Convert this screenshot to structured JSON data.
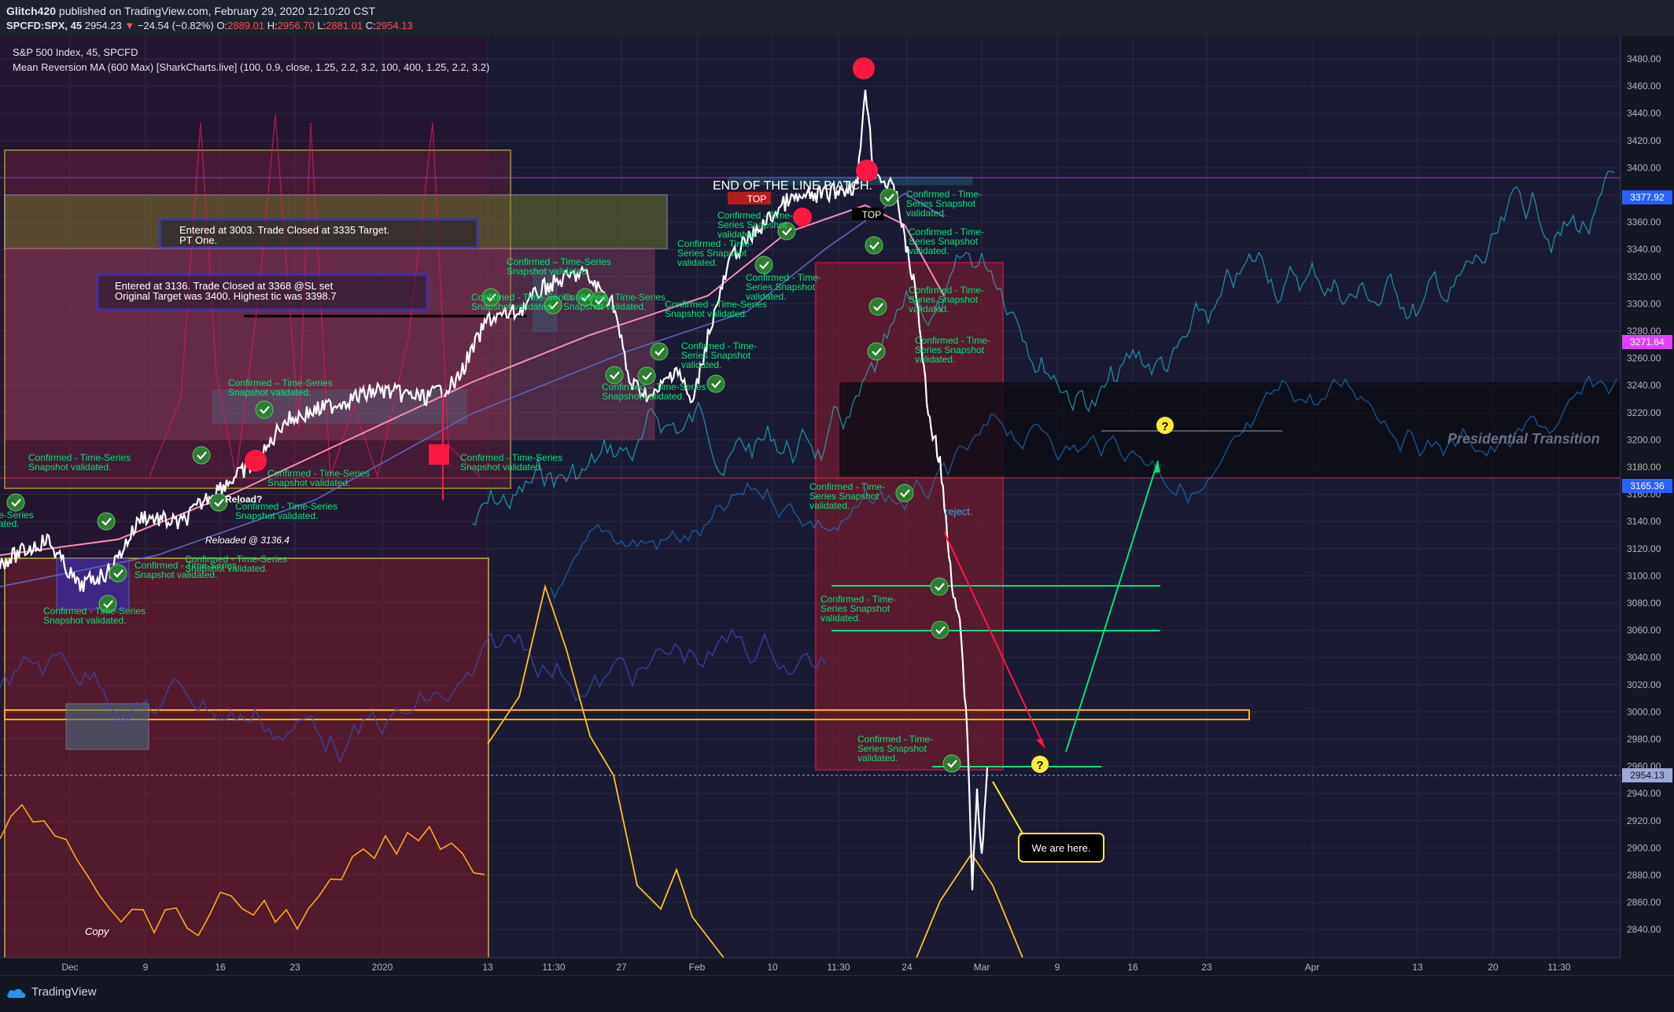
{
  "header": {
    "author": "Glitch420",
    "published": "published on TradingView.com, February 29, 2020 12:10:20 CST",
    "symbol": "SPCFD:SPX, 45",
    "last": "2954.23",
    "change": "−24.54 (−0.82%)",
    "o_label": "O:",
    "o_val": "2889.01",
    "h_label": "H:",
    "h_val": "2956.70",
    "l_label": "L:",
    "l_val": "2881.01",
    "c_label": "C:",
    "c_val": "2954.13"
  },
  "legend": {
    "title": "S&P 500 Index, 45, SPCFD",
    "indicator": "Mean Reversion MA (600 Max) [SharkCharts.live] (100, 0.9, close, 1.25, 2.2, 3.2, 100, 400, 1.25, 2.2, 3.2)"
  },
  "price_axis": {
    "ticks": [
      "3480.00",
      "3460.00",
      "3440.00",
      "3420.00",
      "3400.00",
      "3380.00",
      "3360.00",
      "3340.00",
      "3320.00",
      "3300.00",
      "3280.00",
      "3260.00",
      "3240.00",
      "3220.00",
      "3200.00",
      "3180.00",
      "3160.00",
      "3140.00",
      "3120.00",
      "3100.00",
      "3080.00",
      "3060.00",
      "3040.00",
      "3020.00",
      "3000.00",
      "2980.00",
      "2960.00",
      "2940.00",
      "2920.00",
      "2900.00",
      "2880.00",
      "2860.00",
      "2840.00"
    ],
    "badge_top": "3377.92",
    "badge_pink": "3271.64",
    "badge_mid": "3165.36",
    "badge_last": "2954.13"
  },
  "time_axis": {
    "ticks": [
      "Dec",
      "9",
      "16",
      "23",
      "2020",
      "13",
      "11:30",
      "27",
      "Feb",
      "10",
      "11:30",
      "24",
      "Mar",
      "9",
      "16",
      "23",
      "Apr",
      "13",
      "20",
      "11:30"
    ]
  },
  "annotations": {
    "trade1": "Entered at 3003. Trade Closed  at 3335 Target.\nPT One.",
    "trade2": "Entered at 3136. Trade Closed at 3368 @SL  set\nOriginal Target was 3400. Highest tic was 3398.7",
    "end_of_line": "END OF THE LINE BIATCH.",
    "top1": "TOP",
    "top2": "TOP",
    "presidential": "Presidential Transition",
    "we_are_here": "We are here.",
    "reject": "reject.",
    "reload": "Reload?",
    "reloaded": "Reloaded @ 3136.4",
    "copy": "Copy",
    "confirm1": "Confirmed - Time-Series\nSnapshot validated.",
    "confirm2": "Confirmed - Time-\nSeries Snapshot\nvalidated.",
    "confirm3": "Confirmed – Time-Series\nSnapshot validated.",
    "question": "?",
    "series_frag": "e-Series",
    "validated_frag": "ated."
  },
  "footer": {
    "brand": "TradingView"
  },
  "colors": {
    "background": "#131722",
    "price_line": "#ffffff",
    "confirm_text": "#00ff00",
    "yellow": "#ffeb3b",
    "red_zone": "#ff1744",
    "teal": "#26c6da"
  }
}
